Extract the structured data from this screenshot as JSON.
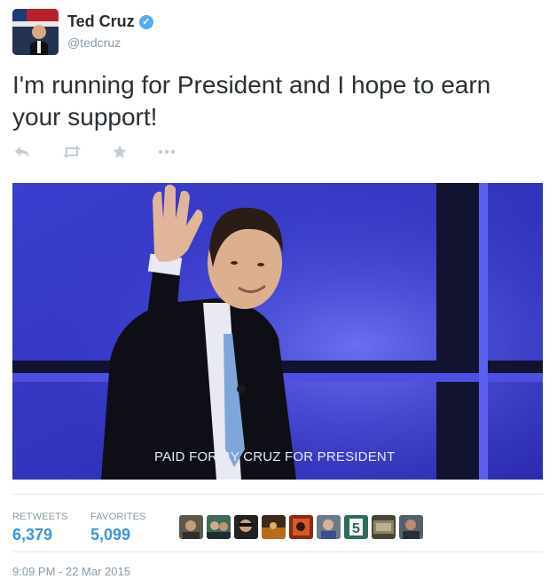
{
  "author": {
    "name": "Ted Cruz",
    "handle": "@tedcruz",
    "verified": true,
    "avatar_icon": "profile-photo"
  },
  "tweet": {
    "text": "I'm running for President and I hope to earn your support!"
  },
  "actions": [
    {
      "name": "reply-icon",
      "glyph": "reply-arrow"
    },
    {
      "name": "retweet-icon",
      "glyph": "retweet-arrows"
    },
    {
      "name": "favorite-icon",
      "glyph": "star"
    },
    {
      "name": "more-icon",
      "glyph": "ellipsis"
    }
  ],
  "media": {
    "caption": "PAID FOR BY CRUZ FOR PRESIDENT"
  },
  "stats": {
    "retweets_label": "RETWEETS",
    "retweets_count": "6,379",
    "favorites_label": "FAVORITES",
    "favorites_count": "5,099"
  },
  "favoriters_count_shown": 9,
  "timestamp": "9:09 PM - 22 Mar 2015",
  "colors": {
    "link_blue": "#3b94d9",
    "verified_blue": "#55acee",
    "muted_gray": "#8899a6",
    "text": "#292f33"
  }
}
